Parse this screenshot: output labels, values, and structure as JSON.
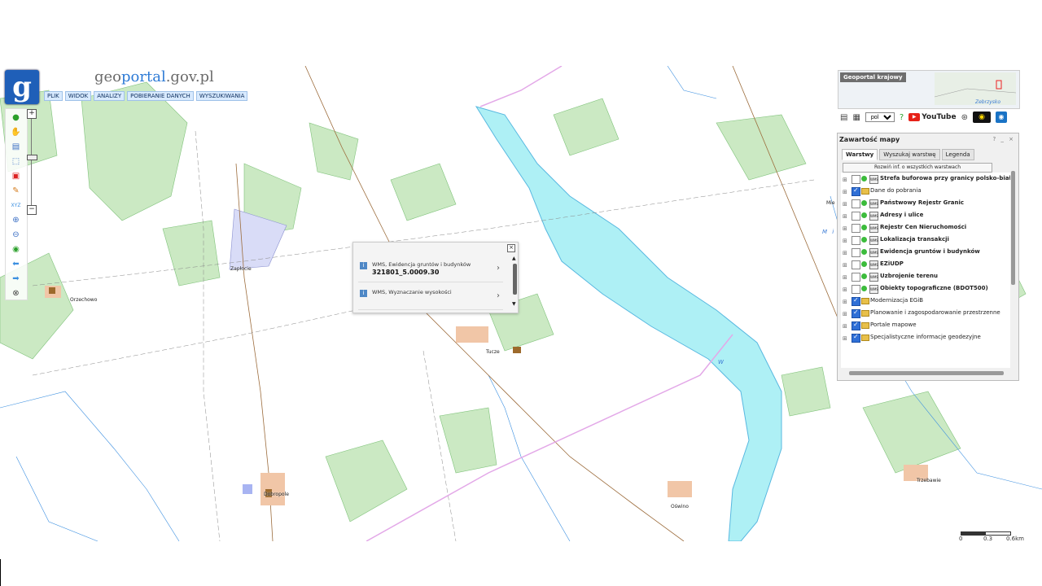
{
  "header": {
    "brand_part1": "geo",
    "brand_part2": "portal",
    "brand_part3": ".gov.pl",
    "logo_letter": "g"
  },
  "menu": [
    "PLIK",
    "WIDOK",
    "ANALIZY",
    "POBIERANIE DANYCH",
    "WYSZUKIWANIA"
  ],
  "map_labels": {
    "zaplocie": "Zapłocie",
    "orzechowo": "Orzechowo",
    "tucze": "Tucze",
    "dobropole": "Dobropole",
    "oswino": "Oświno",
    "trzebawie": "Trzebawie",
    "mielno": "Mie",
    "lake_w": "W",
    "lake_mie": "M i e",
    "minimap_label": "Zebrzysko"
  },
  "popup": {
    "rows": [
      {
        "title": "WMS, Ewidencja gruntów i budynków",
        "value": "321801_5.0009.30"
      },
      {
        "title": "WMS, Wyznaczanie wysokości",
        "value": ""
      }
    ]
  },
  "right_header": {
    "geoportal_krajowy": "Geoportal krajowy",
    "language": "pol",
    "youtube": "YouTube"
  },
  "panel": {
    "title": "Zawartość mapy",
    "window_buttons": "? _ ×",
    "tabs": [
      "Warstwy",
      "Wyszukaj warstwę",
      "Legenda"
    ],
    "expand_all": "Rozwiń inf. o wszystkich warstwach",
    "layers": [
      {
        "name": "Strefa buforowa przy granicy polsko-białoruskiej",
        "checked": false,
        "kind": "wms",
        "bold": true
      },
      {
        "name": "Dane do pobrania",
        "checked": true,
        "kind": "folder",
        "bold": false
      },
      {
        "name": "Państwowy Rejestr Granic",
        "checked": false,
        "kind": "wms",
        "bold": true
      },
      {
        "name": "Adresy i ulice",
        "checked": false,
        "kind": "wms",
        "bold": true
      },
      {
        "name": "Rejestr Cen Nieruchomości",
        "checked": false,
        "kind": "wms",
        "bold": true
      },
      {
        "name": "Lokalizacja transakcji",
        "checked": false,
        "kind": "wms",
        "bold": true
      },
      {
        "name": "Ewidencja gruntów i budynków",
        "checked": false,
        "kind": "wms",
        "bold": true
      },
      {
        "name": "EZiUDP",
        "checked": false,
        "kind": "wms",
        "bold": true
      },
      {
        "name": "Uzbrojenie terenu",
        "checked": false,
        "kind": "wms",
        "bold": true
      },
      {
        "name": "Obiekty topograficzne (BDOT500)",
        "checked": false,
        "kind": "wms",
        "bold": true
      },
      {
        "name": "Modernizacja EGiB",
        "checked": true,
        "kind": "folder",
        "bold": false
      },
      {
        "name": "Planowanie i zagospodarowanie przestrzenne",
        "checked": true,
        "kind": "folder",
        "bold": false
      },
      {
        "name": "Portale mapowe",
        "checked": true,
        "kind": "folder",
        "bold": false
      },
      {
        "name": "Specjalistyczne informacje geodezyjne",
        "checked": true,
        "kind": "folder",
        "bold": false
      }
    ]
  },
  "scale": {
    "l0": "0",
    "l1": "0.3",
    "l2": "0.6km"
  },
  "colors": {
    "water": "#aef0f5",
    "forest": "#c8e8c0",
    "accent": "#1f5fb8"
  }
}
